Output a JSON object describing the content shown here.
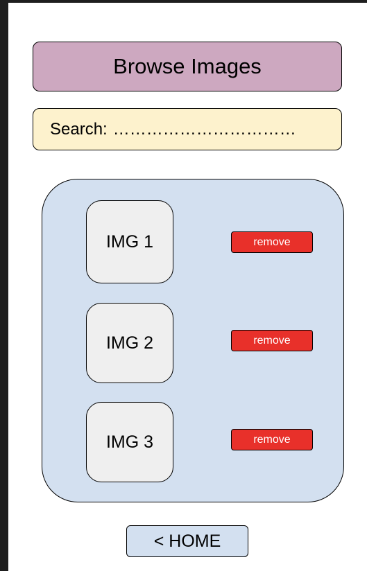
{
  "header": {
    "title": "Browse Images"
  },
  "search": {
    "label": "Search:",
    "placeholder": "……………………………"
  },
  "images": [
    {
      "label": "IMG 1",
      "action_label": "remove"
    },
    {
      "label": "IMG 2",
      "action_label": "remove"
    },
    {
      "label": "IMG 3",
      "action_label": "remove"
    }
  ],
  "footer": {
    "home_label": "< HOME"
  },
  "colors": {
    "header_bg": "#cda8c0",
    "search_bg": "#fdf2cd",
    "panel_bg": "#d3e0f0",
    "thumb_bg": "#efefef",
    "remove_bg": "#e8302a",
    "home_bg": "#d3e0f0",
    "page_frame": "#1e1e1e"
  }
}
